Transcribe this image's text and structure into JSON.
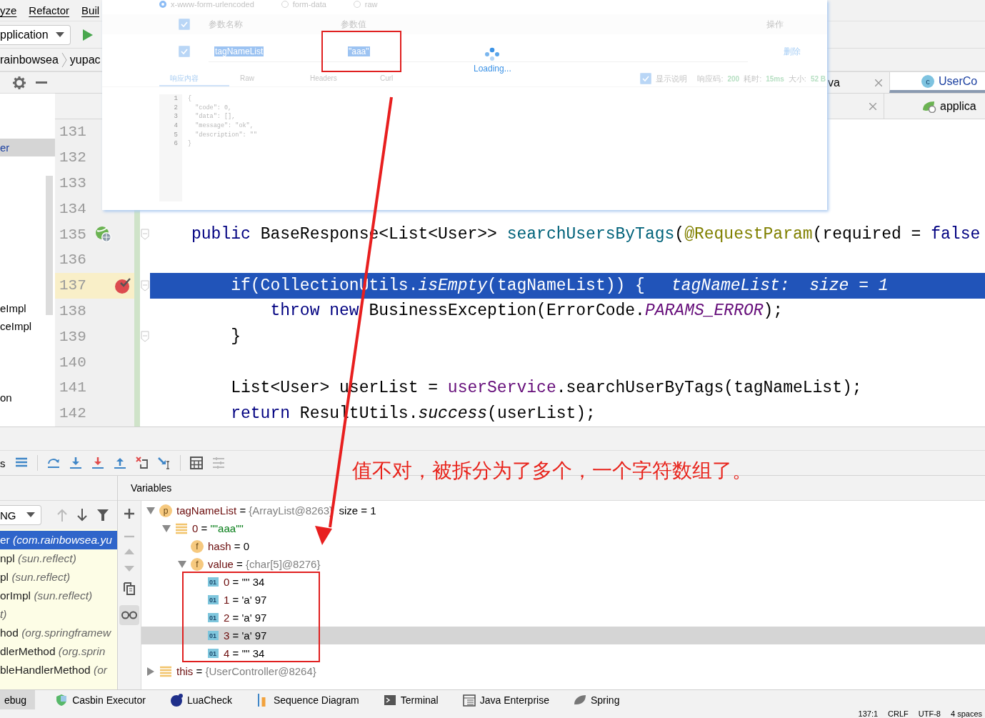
{
  "menu_bar": {
    "items": [
      "yze",
      "Refactor",
      "Buil"
    ]
  },
  "toolbar": {
    "run_config": "pplication"
  },
  "breadcrumb": [
    "rainbowsea",
    "yupac"
  ],
  "project_panel": {
    "items": [
      {
        "label": "er",
        "selected": true
      },
      {
        "label": "eImpl",
        "selected": false
      },
      {
        "label": "ceImpl",
        "selected": false
      },
      {
        "label": "on",
        "selected": false
      }
    ]
  },
  "editor_tabs": [
    {
      "tabs": [
        {
          "label": "va",
          "kind": "plain",
          "selected": false,
          "closable": true
        },
        {
          "label": "UserCo",
          "kind": "class",
          "badge": "c",
          "selected": true,
          "closable": false
        }
      ]
    },
    {
      "tabs": [
        {
          "kind": "plain",
          "selected": false,
          "closable": true
        },
        {
          "label": "applica",
          "kind": "spring",
          "selected": false,
          "closable": false
        }
      ]
    }
  ],
  "editor": {
    "lines": [
      {
        "number": "131",
        "current": false,
        "fold": false
      },
      {
        "number": "132",
        "current": false,
        "fold": false
      },
      {
        "number": "133",
        "current": false,
        "fold": false
      },
      {
        "number": "134",
        "current": false,
        "fold": false
      },
      {
        "number": "135",
        "current": false,
        "fold": true,
        "marker": {
          "kind": "endpoint"
        },
        "tokens": [
          {
            "t": "public",
            "kind": "keyword"
          },
          {
            "t": " BaseResponse<List<User>> ",
            "kind": "plain"
          },
          {
            "t": "searchUsersByTags",
            "kind": "method"
          },
          {
            "t": "(",
            "kind": "plain"
          },
          {
            "t": "@RequestParam",
            "kind": "annotation"
          },
          {
            "t": "(required = ",
            "kind": "plain"
          },
          {
            "t": "false",
            "kind": "keyword"
          }
        ]
      },
      {
        "number": "136",
        "current": false,
        "fold": false
      },
      {
        "number": "137",
        "current": true,
        "fold": true,
        "marker": {
          "kind": "breakpoint"
        },
        "tokens": [
          {
            "t": "    if(CollectionUtils.",
            "kind": "plain"
          },
          {
            "t": "isEmpty",
            "kind": "static"
          },
          {
            "t": "(tagNameList)) {",
            "kind": "plain"
          }
        ],
        "inline_value": "tagNameList:  size = 1"
      },
      {
        "number": "138",
        "current": false,
        "fold": false,
        "tokens": [
          {
            "t": "        throw",
            "kind": "keyword"
          },
          {
            "t": " new",
            "kind": "keyword"
          },
          {
            "t": " BusinessException(ErrorCode.",
            "kind": "plain"
          },
          {
            "t": "PARAMS_ERROR",
            "kind": "constant"
          },
          {
            "t": ");",
            "kind": "plain"
          }
        ]
      },
      {
        "number": "139",
        "current": false,
        "fold": true,
        "tokens": [
          {
            "t": "    }",
            "kind": "plain"
          }
        ]
      },
      {
        "number": "140",
        "current": false,
        "fold": false
      },
      {
        "number": "141",
        "current": false,
        "fold": false,
        "tokens": [
          {
            "t": "    List<User> userList = ",
            "kind": "plain"
          },
          {
            "t": "userService",
            "kind": "field"
          },
          {
            "t": ".searchUserByTags(tagNameList);",
            "kind": "plain"
          }
        ]
      },
      {
        "number": "142",
        "current": false,
        "fold": false,
        "tokens": [
          {
            "t": "    return",
            "kind": "keyword"
          },
          {
            "t": " ResultUtils.",
            "kind": "plain"
          },
          {
            "t": "success",
            "kind": "static"
          },
          {
            "t": "(userList);",
            "kind": "plain"
          }
        ]
      }
    ]
  },
  "rest_client": {
    "body_types": [
      {
        "label": "x-www-form-urlencoded",
        "selected": true
      },
      {
        "label": "form-data",
        "selected": false
      },
      {
        "label": "raw",
        "selected": false
      }
    ],
    "params": {
      "columns": [
        "参数名称",
        "参数值",
        "操作"
      ],
      "all_checked": true,
      "rows": [
        {
          "checked": true,
          "name": "tagNameList",
          "value": "\"aaa\"",
          "action": "删除"
        }
      ]
    },
    "loading": "Loading...",
    "response_tabs": [
      {
        "label": "响应内容",
        "selected": true
      },
      {
        "label": "Raw",
        "selected": false
      },
      {
        "label": "Headers",
        "selected": false
      },
      {
        "label": "Curl",
        "selected": false
      }
    ],
    "show_description": {
      "label": "显示说明",
      "checked": true
    },
    "stats": [
      {
        "label": "响应码:",
        "value": "200"
      },
      {
        "label": "耗时:",
        "value": "15ms"
      },
      {
        "label": "大小:",
        "value": "52 B"
      }
    ],
    "response_lines": [
      {
        "number": "1",
        "text": "{"
      },
      {
        "number": "2",
        "text": "  \"code\": 0,"
      },
      {
        "number": "3",
        "text": "  \"data\": [],"
      },
      {
        "number": "4",
        "text": "  \"message\": \"ok\","
      },
      {
        "number": "5",
        "text": "  \"description\": \"\""
      },
      {
        "number": "6",
        "text": "}"
      }
    ]
  },
  "debugger": {
    "toolbar_label": "s",
    "frames_filter": "NG",
    "frames": [
      {
        "name": "er",
        "location": "(com.rainbowsea.yu",
        "selected": true
      },
      {
        "name": "npl",
        "location": "(sun.reflect)",
        "selected": false
      },
      {
        "name": "pl",
        "location": "(sun.reflect)",
        "selected": false
      },
      {
        "name": "orImpl",
        "location": "(sun.reflect)",
        "selected": false
      },
      {
        "location": "t)",
        "selected": false
      },
      {
        "name": "hod",
        "location": "(org.springframew",
        "selected": false
      },
      {
        "name": "dlerMethod",
        "location": "(org.sprin",
        "selected": false
      },
      {
        "name": "bleHandlerMethod",
        "location": "(or",
        "selected": false
      }
    ],
    "variables_title": "Variables",
    "variables": [
      {
        "kind": "param",
        "badge": "p",
        "name": "tagNameList",
        "operator": "=",
        "value": {
          "text": "{ArrayList@8263}",
          "kind": "object"
        },
        "extra": "size = 1",
        "expanded": true,
        "selected": false,
        "children": [
          {
            "kind": "list",
            "name": "0",
            "operator": "=",
            "value": {
              "text": "\"\"aaa\"\"",
              "kind": "string"
            },
            "expanded": true,
            "selected": false,
            "children": [
              {
                "kind": "field",
                "badge": "f",
                "name": "hash",
                "operator": "=",
                "value": {
                  "text": "0",
                  "kind": "plain"
                },
                "selected": false
              },
              {
                "kind": "field",
                "badge": "f",
                "name": "value",
                "operator": "=",
                "value": {
                  "text": "{char[5]@8276}",
                  "kind": "object"
                },
                "expanded": true,
                "selected": false,
                "children": [
                  {
                    "kind": "element",
                    "badge": "01",
                    "name": "0",
                    "operator": "=",
                    "value": {
                      "text": "'\"' 34",
                      "kind": "plain"
                    },
                    "selected": false
                  },
                  {
                    "kind": "element",
                    "badge": "01",
                    "name": "1",
                    "operator": "=",
                    "value": {
                      "text": "'a' 97",
                      "kind": "plain"
                    },
                    "selected": false
                  },
                  {
                    "kind": "element",
                    "badge": "01",
                    "name": "2",
                    "operator": "=",
                    "value": {
                      "text": "'a' 97",
                      "kind": "plain"
                    },
                    "selected": false
                  },
                  {
                    "kind": "element",
                    "badge": "01",
                    "name": "3",
                    "operator": "=",
                    "value": {
                      "text": "'a' 97",
                      "kind": "plain"
                    },
                    "selected": true
                  },
                  {
                    "kind": "element",
                    "badge": "01",
                    "name": "4",
                    "operator": "=",
                    "value": {
                      "text": "'\"' 34",
                      "kind": "plain"
                    },
                    "selected": false
                  }
                ]
              }
            ]
          }
        ]
      },
      {
        "kind": "list",
        "name": "this",
        "operator": "=",
        "value": {
          "text": "{UserController@8264}",
          "kind": "object"
        },
        "expanded": false,
        "selected": false
      }
    ]
  },
  "tool_windows": [
    {
      "label": "ebug",
      "kind": "debug",
      "selected": true
    },
    {
      "label": "Casbin Executor",
      "kind": "casbin",
      "selected": false
    },
    {
      "label": "LuaCheck",
      "kind": "lua",
      "selected": false
    },
    {
      "label": "Sequence Diagram",
      "kind": "sequence",
      "selected": false
    },
    {
      "label": "Terminal",
      "kind": "terminal",
      "selected": false
    },
    {
      "label": "Java Enterprise",
      "kind": "enterprise",
      "selected": false
    },
    {
      "label": "Spring",
      "kind": "spring",
      "selected": false
    }
  ],
  "status_bar": [
    "137:1",
    "CRLF",
    "UTF-8",
    "4 spaces"
  ],
  "annotation": {
    "note": "值不对，被拆分为了多个，一个字符数组了。"
  }
}
